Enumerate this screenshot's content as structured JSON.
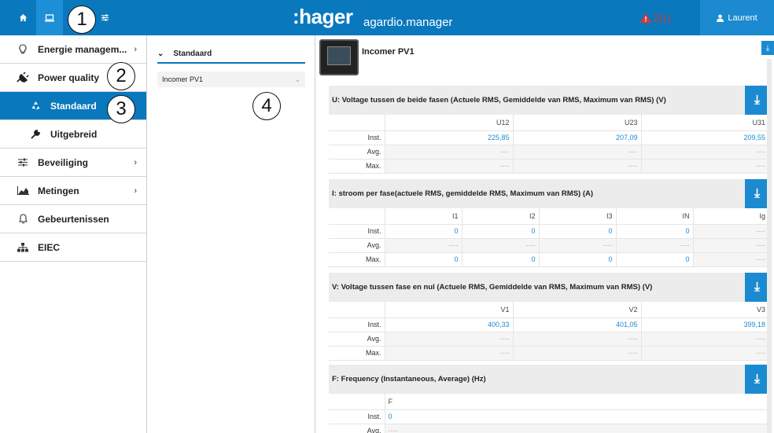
{
  "topbar": {
    "logo": ":hager",
    "app_name": "agardio.manager",
    "alert_count": "2(1)",
    "user_name": "Laurent",
    "home_icon": "home-icon",
    "monitor_icon": "monitor-icon",
    "settings_icon": "sliders-icon"
  },
  "callouts": [
    "1",
    "2",
    "3",
    "4"
  ],
  "sidebar": {
    "items": [
      {
        "label": "Energie managem...",
        "icon": "lightbulb-icon",
        "has_chevron": true
      },
      {
        "label": "Power quality",
        "icon": "plug-icon",
        "has_chevron": false
      },
      {
        "label": "Standaard",
        "icon": "recycle-icon",
        "active": true
      },
      {
        "label": "Uitgebreid",
        "icon": "wrench-icon"
      },
      {
        "label": "Beveiliging",
        "icon": "sliders-icon",
        "has_chevron": true
      },
      {
        "label": "Metingen",
        "icon": "chart-icon",
        "has_chevron": true
      },
      {
        "label": "Gebeurtenissen",
        "icon": "bell-icon"
      },
      {
        "label": "EIEC",
        "icon": "hierarchy-icon"
      }
    ]
  },
  "middle": {
    "header": "Standaard",
    "selected_device": "Incomer PV1"
  },
  "main": {
    "device_title": "Incomer PV1",
    "panels": [
      {
        "title": "U: Voltage tussen de beide fasen (Actuele RMS, Gemiddelde van RMS, Maximum van RMS) (V)",
        "columns": [
          "U12",
          "U23",
          "U31"
        ],
        "rows": [
          {
            "label": "Inst.",
            "values": [
              "225,85",
              "207,09",
              "209,55"
            ]
          },
          {
            "label": "Avg.",
            "values": [
              "----",
              "----",
              "----"
            ]
          },
          {
            "label": "Max.",
            "values": [
              "----",
              "----",
              "----"
            ]
          }
        ]
      },
      {
        "title": "I: stroom per fase(actuele RMS, gemiddelde RMS, Maximum van RMS) (A)",
        "columns": [
          "I1",
          "I2",
          "I3",
          "IN",
          "Ig"
        ],
        "rows": [
          {
            "label": "Inst.",
            "values": [
              "0",
              "0",
              "0",
              "0",
              "----"
            ]
          },
          {
            "label": "Avg.",
            "values": [
              "----",
              "----",
              "----",
              "----",
              "----"
            ]
          },
          {
            "label": "Max.",
            "values": [
              "0",
              "0",
              "0",
              "0",
              "----"
            ]
          }
        ]
      },
      {
        "title": "V: Voltage tussen fase en nul (Actuele RMS, Gemiddelde van RMS, Maximum van RMS) (V)",
        "columns": [
          "V1",
          "V2",
          "V3"
        ],
        "rows": [
          {
            "label": "Inst.",
            "values": [
              "400,33",
              "401,05",
              "399,18"
            ]
          },
          {
            "label": "Avg.",
            "values": [
              "----",
              "----",
              "----"
            ]
          },
          {
            "label": "Max.",
            "values": [
              "----",
              "----",
              "----"
            ]
          }
        ]
      },
      {
        "title": "F: Frequency (Instantaneous, Average) (Hz)",
        "columns": [
          "F"
        ],
        "rows": [
          {
            "label": "Inst.",
            "values": [
              "0"
            ]
          },
          {
            "label": "Avg.",
            "values": [
              "----"
            ]
          }
        ]
      }
    ]
  },
  "colors": {
    "primary": "#0a78bd",
    "accent": "#1b8ad0",
    "alert": "#e7332f"
  }
}
